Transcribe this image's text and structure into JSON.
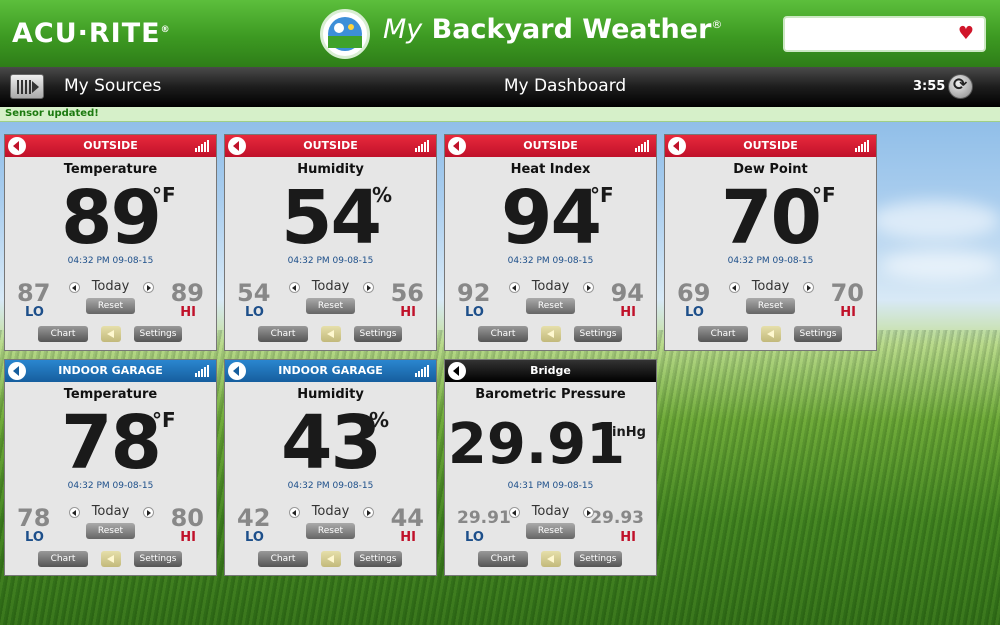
{
  "header": {
    "logo_text": "ACU·RITE",
    "logo_reg": "®",
    "title_my": "My",
    "title_rest": " Backyard Weather",
    "title_reg": "®"
  },
  "toolbar": {
    "my_sources": "My Sources",
    "dashboard_title": "My Dashboard",
    "time": "3:55"
  },
  "status": {
    "text": "Sensor updated!"
  },
  "colors": {
    "red_head": "#d0152a",
    "blue_head": "#1f73b8",
    "black_head": "#000000",
    "lo": "#1d4f8a",
    "hi": "#c0112a"
  },
  "tiles": [
    {
      "source": "OUTSIDE",
      "title": "Temperature",
      "value": "89",
      "unit": "°F",
      "timestamp": "04:32 PM 09-08-15",
      "lo": "87",
      "hi": "89"
    },
    {
      "source": "OUTSIDE",
      "title": "Humidity",
      "value": "54",
      "unit": "%",
      "timestamp": "04:32 PM 09-08-15",
      "lo": "54",
      "hi": "56"
    },
    {
      "source": "OUTSIDE",
      "title": "Heat Index",
      "value": "94",
      "unit": "°F",
      "timestamp": "04:32 PM 09-08-15",
      "lo": "92",
      "hi": "94"
    },
    {
      "source": "OUTSIDE",
      "title": "Dew Point",
      "value": "70",
      "unit": "°F",
      "timestamp": "04:32 PM 09-08-15",
      "lo": "69",
      "hi": "70"
    },
    {
      "source": "INDOOR GARAGE",
      "title": "Temperature",
      "value": "78",
      "unit": "°F",
      "timestamp": "04:32 PM 09-08-15",
      "lo": "78",
      "hi": "80"
    },
    {
      "source": "INDOOR GARAGE",
      "title": "Humidity",
      "value": "43",
      "unit": "%",
      "timestamp": "04:32 PM 09-08-15",
      "lo": "42",
      "hi": "44"
    },
    {
      "source": "Bridge",
      "title": "Barometric Pressure",
      "value": "29.91",
      "unit": "inHg",
      "timestamp": "04:31 PM 09-08-15",
      "lo": "29.91",
      "hi": "29.93"
    }
  ],
  "labels": {
    "today": "Today",
    "reset": "Reset",
    "lo": "LO",
    "hi": "HI",
    "chart": "Chart",
    "settings": "Settings"
  }
}
